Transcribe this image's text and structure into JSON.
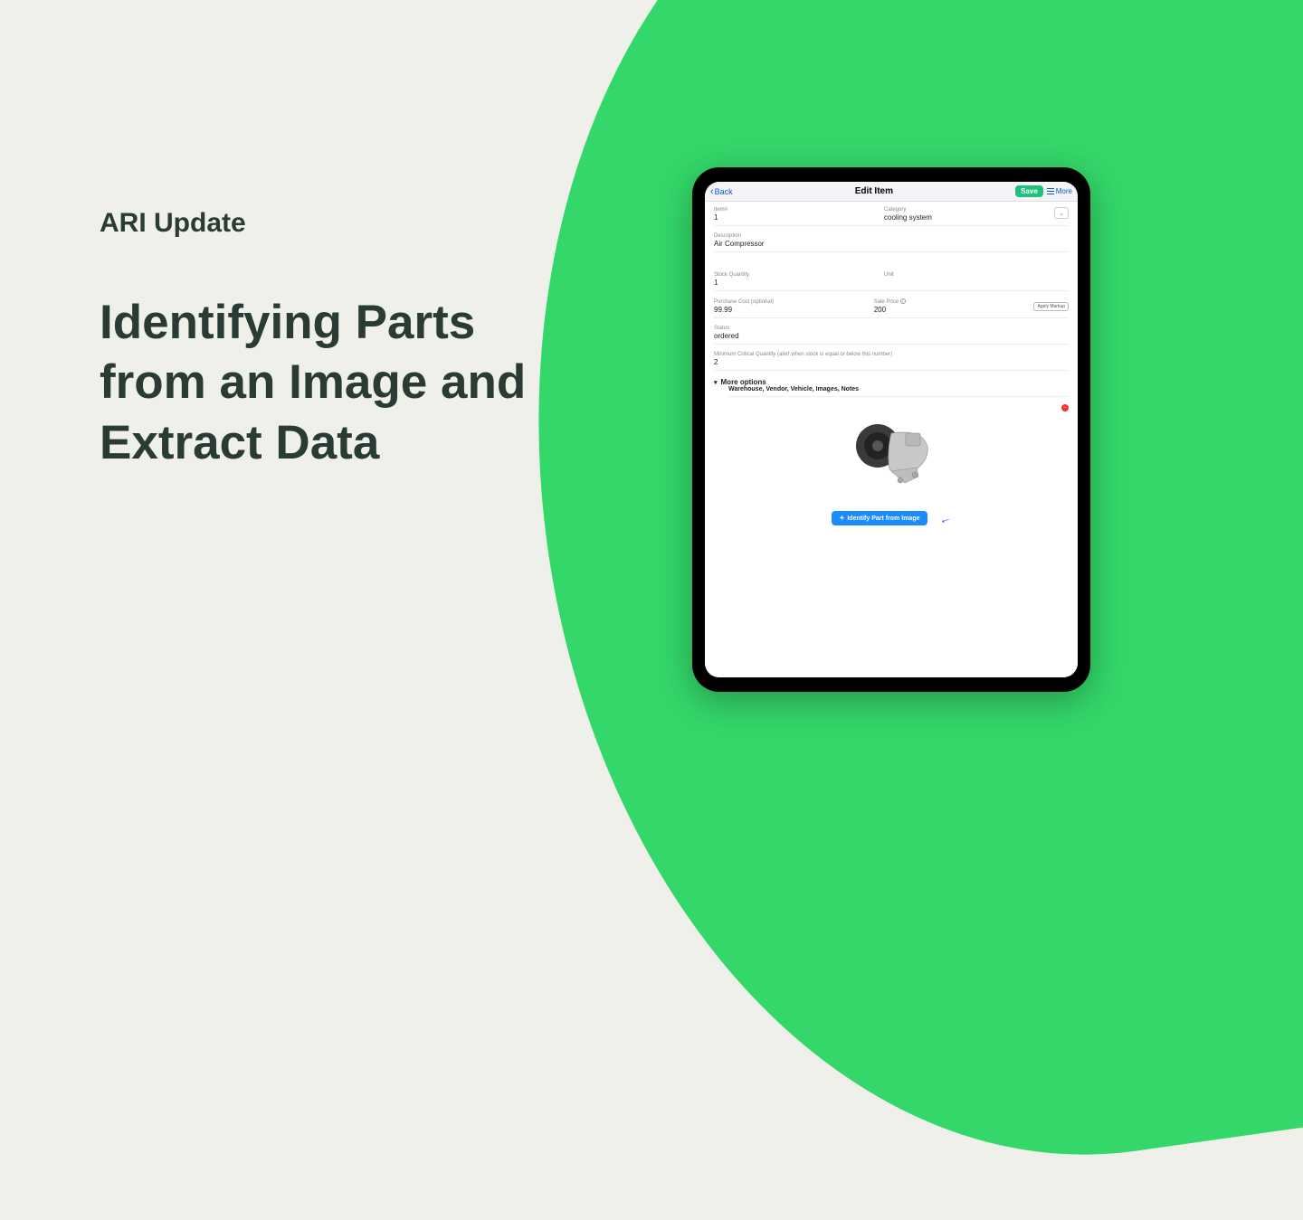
{
  "kicker": "ARI Update",
  "headline": "Identifying Parts from an Image and Extract Data",
  "tablet": {
    "navbar": {
      "back": "Back",
      "title": "Edit Item",
      "save": "Save",
      "more": "More"
    },
    "fields": {
      "item_label": "Item#",
      "item_value": "1",
      "category_label": "Category",
      "category_value": "cooling system",
      "description_label": "Description",
      "description_value": "Air Compressor",
      "stock_label": "Stock Quantity",
      "stock_value": "1",
      "unit_label": "Unit",
      "unit_value": "",
      "purchase_label": "Purchase Cost (optional)",
      "purchase_value": "99.99",
      "sale_label": "Sale Price",
      "sale_value": "200",
      "markup_btn": "Apply Markup",
      "status_label": "Status",
      "status_value": "ordered",
      "mincrit_label": "Minimum Critical Quantity (alert when stock is equal or below this number)",
      "mincrit_value": "2"
    },
    "more_options": {
      "title": "More options",
      "subtitle": "Warehouse, Vendor, Vehicle, Images, Notes"
    },
    "identify_btn": "Identify Part from Image"
  }
}
